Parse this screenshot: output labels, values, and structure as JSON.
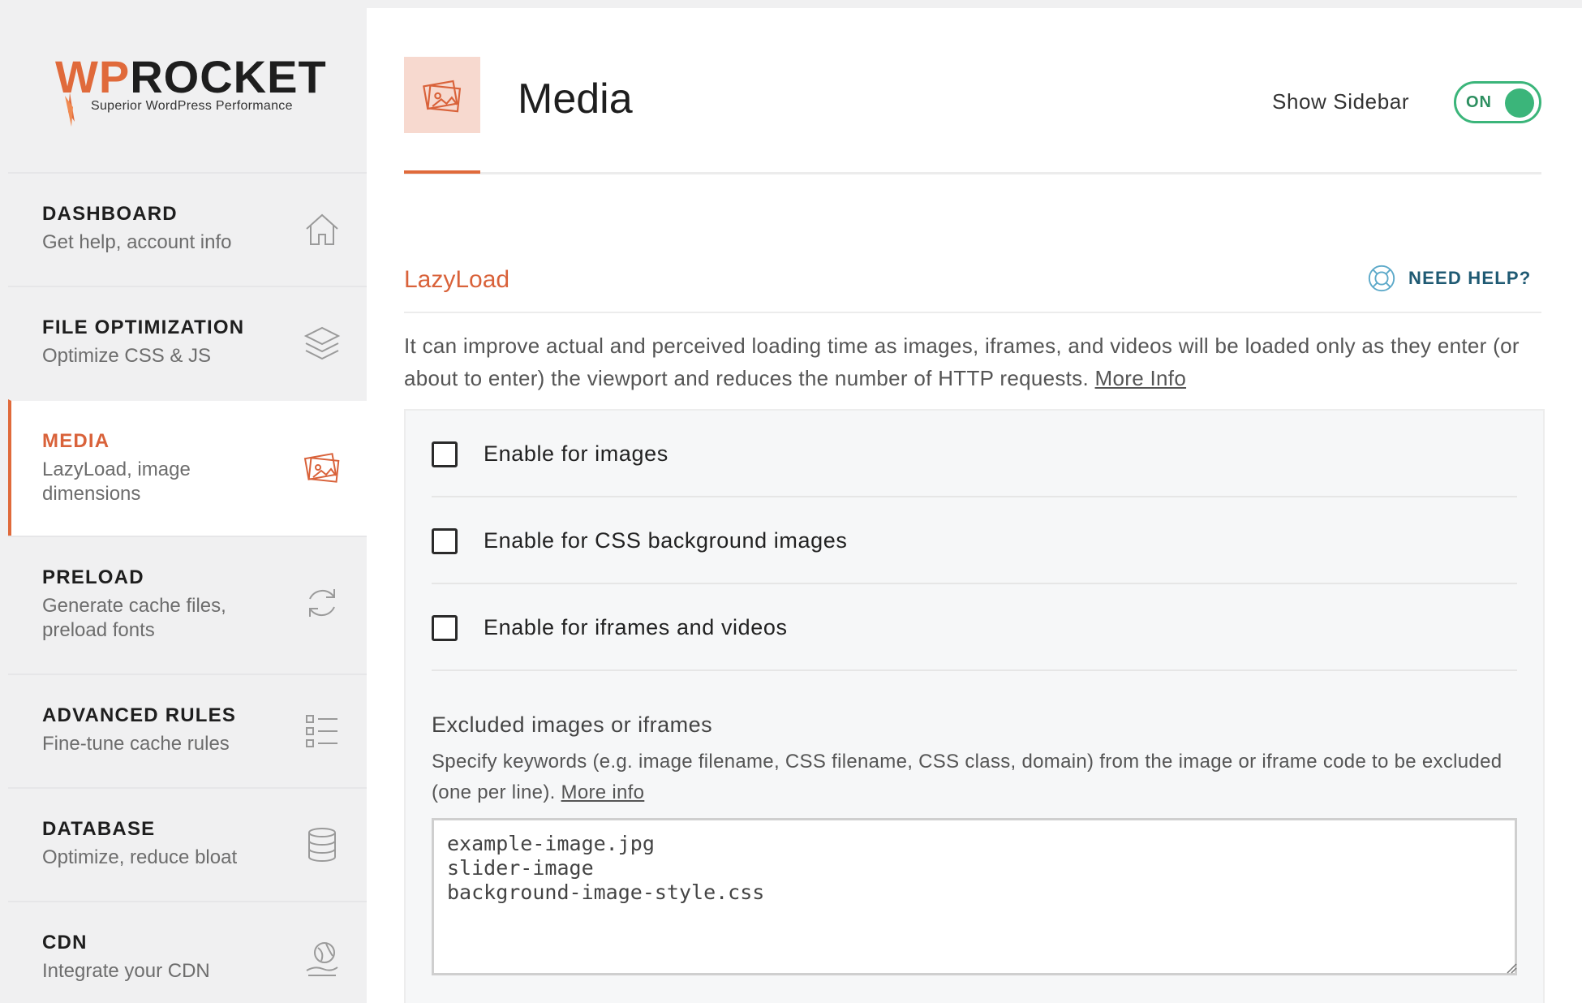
{
  "brand": {
    "word_wp": "WP",
    "word_rocket": "ROCKET",
    "tagline": "Superior WordPress Performance",
    "accent": "#e06a3b"
  },
  "sidebar": {
    "items": [
      {
        "title": "DASHBOARD",
        "subtitle": "Get help, account info",
        "icon": "home-icon",
        "active": false
      },
      {
        "title": "FILE OPTIMIZATION",
        "subtitle": "Optimize CSS & JS",
        "icon": "layers-icon",
        "active": false
      },
      {
        "title": "MEDIA",
        "subtitle": "LazyLoad, image dimensions",
        "icon": "images-icon",
        "active": true
      },
      {
        "title": "PRELOAD",
        "subtitle": "Generate cache files, preload fonts",
        "icon": "refresh-icon",
        "active": false
      },
      {
        "title": "ADVANCED RULES",
        "subtitle": "Fine-tune cache rules",
        "icon": "checklist-icon",
        "active": false
      },
      {
        "title": "DATABASE",
        "subtitle": "Optimize, reduce bloat",
        "icon": "database-icon",
        "active": false
      },
      {
        "title": "CDN",
        "subtitle": "Integrate your CDN",
        "icon": "cdn-icon",
        "active": false
      }
    ]
  },
  "header": {
    "title": "Media",
    "show_sidebar_label": "Show Sidebar",
    "toggle_label": "ON",
    "toggle_color": "#3bb57a"
  },
  "lazyload": {
    "title": "LazyLoad",
    "need_help": "NEED HELP?",
    "description": "It can improve actual and perceived loading time as images, iframes, and videos will be loaded only as they enter (or about to enter) the viewport and reduces the number of HTTP requests.",
    "more_info": "More Info",
    "options": [
      {
        "label": "Enable for images",
        "checked": false
      },
      {
        "label": "Enable for CSS background images",
        "checked": false
      },
      {
        "label": "Enable for iframes and videos",
        "checked": false
      }
    ],
    "excluded": {
      "title": "Excluded images or iframes",
      "description": "Specify keywords (e.g. image filename, CSS filename, CSS class, domain) from the image or iframe code to be excluded (one per line).",
      "more_info": "More info",
      "value": "example-image.jpg\nslider-image\nbackground-image-style.css"
    }
  }
}
